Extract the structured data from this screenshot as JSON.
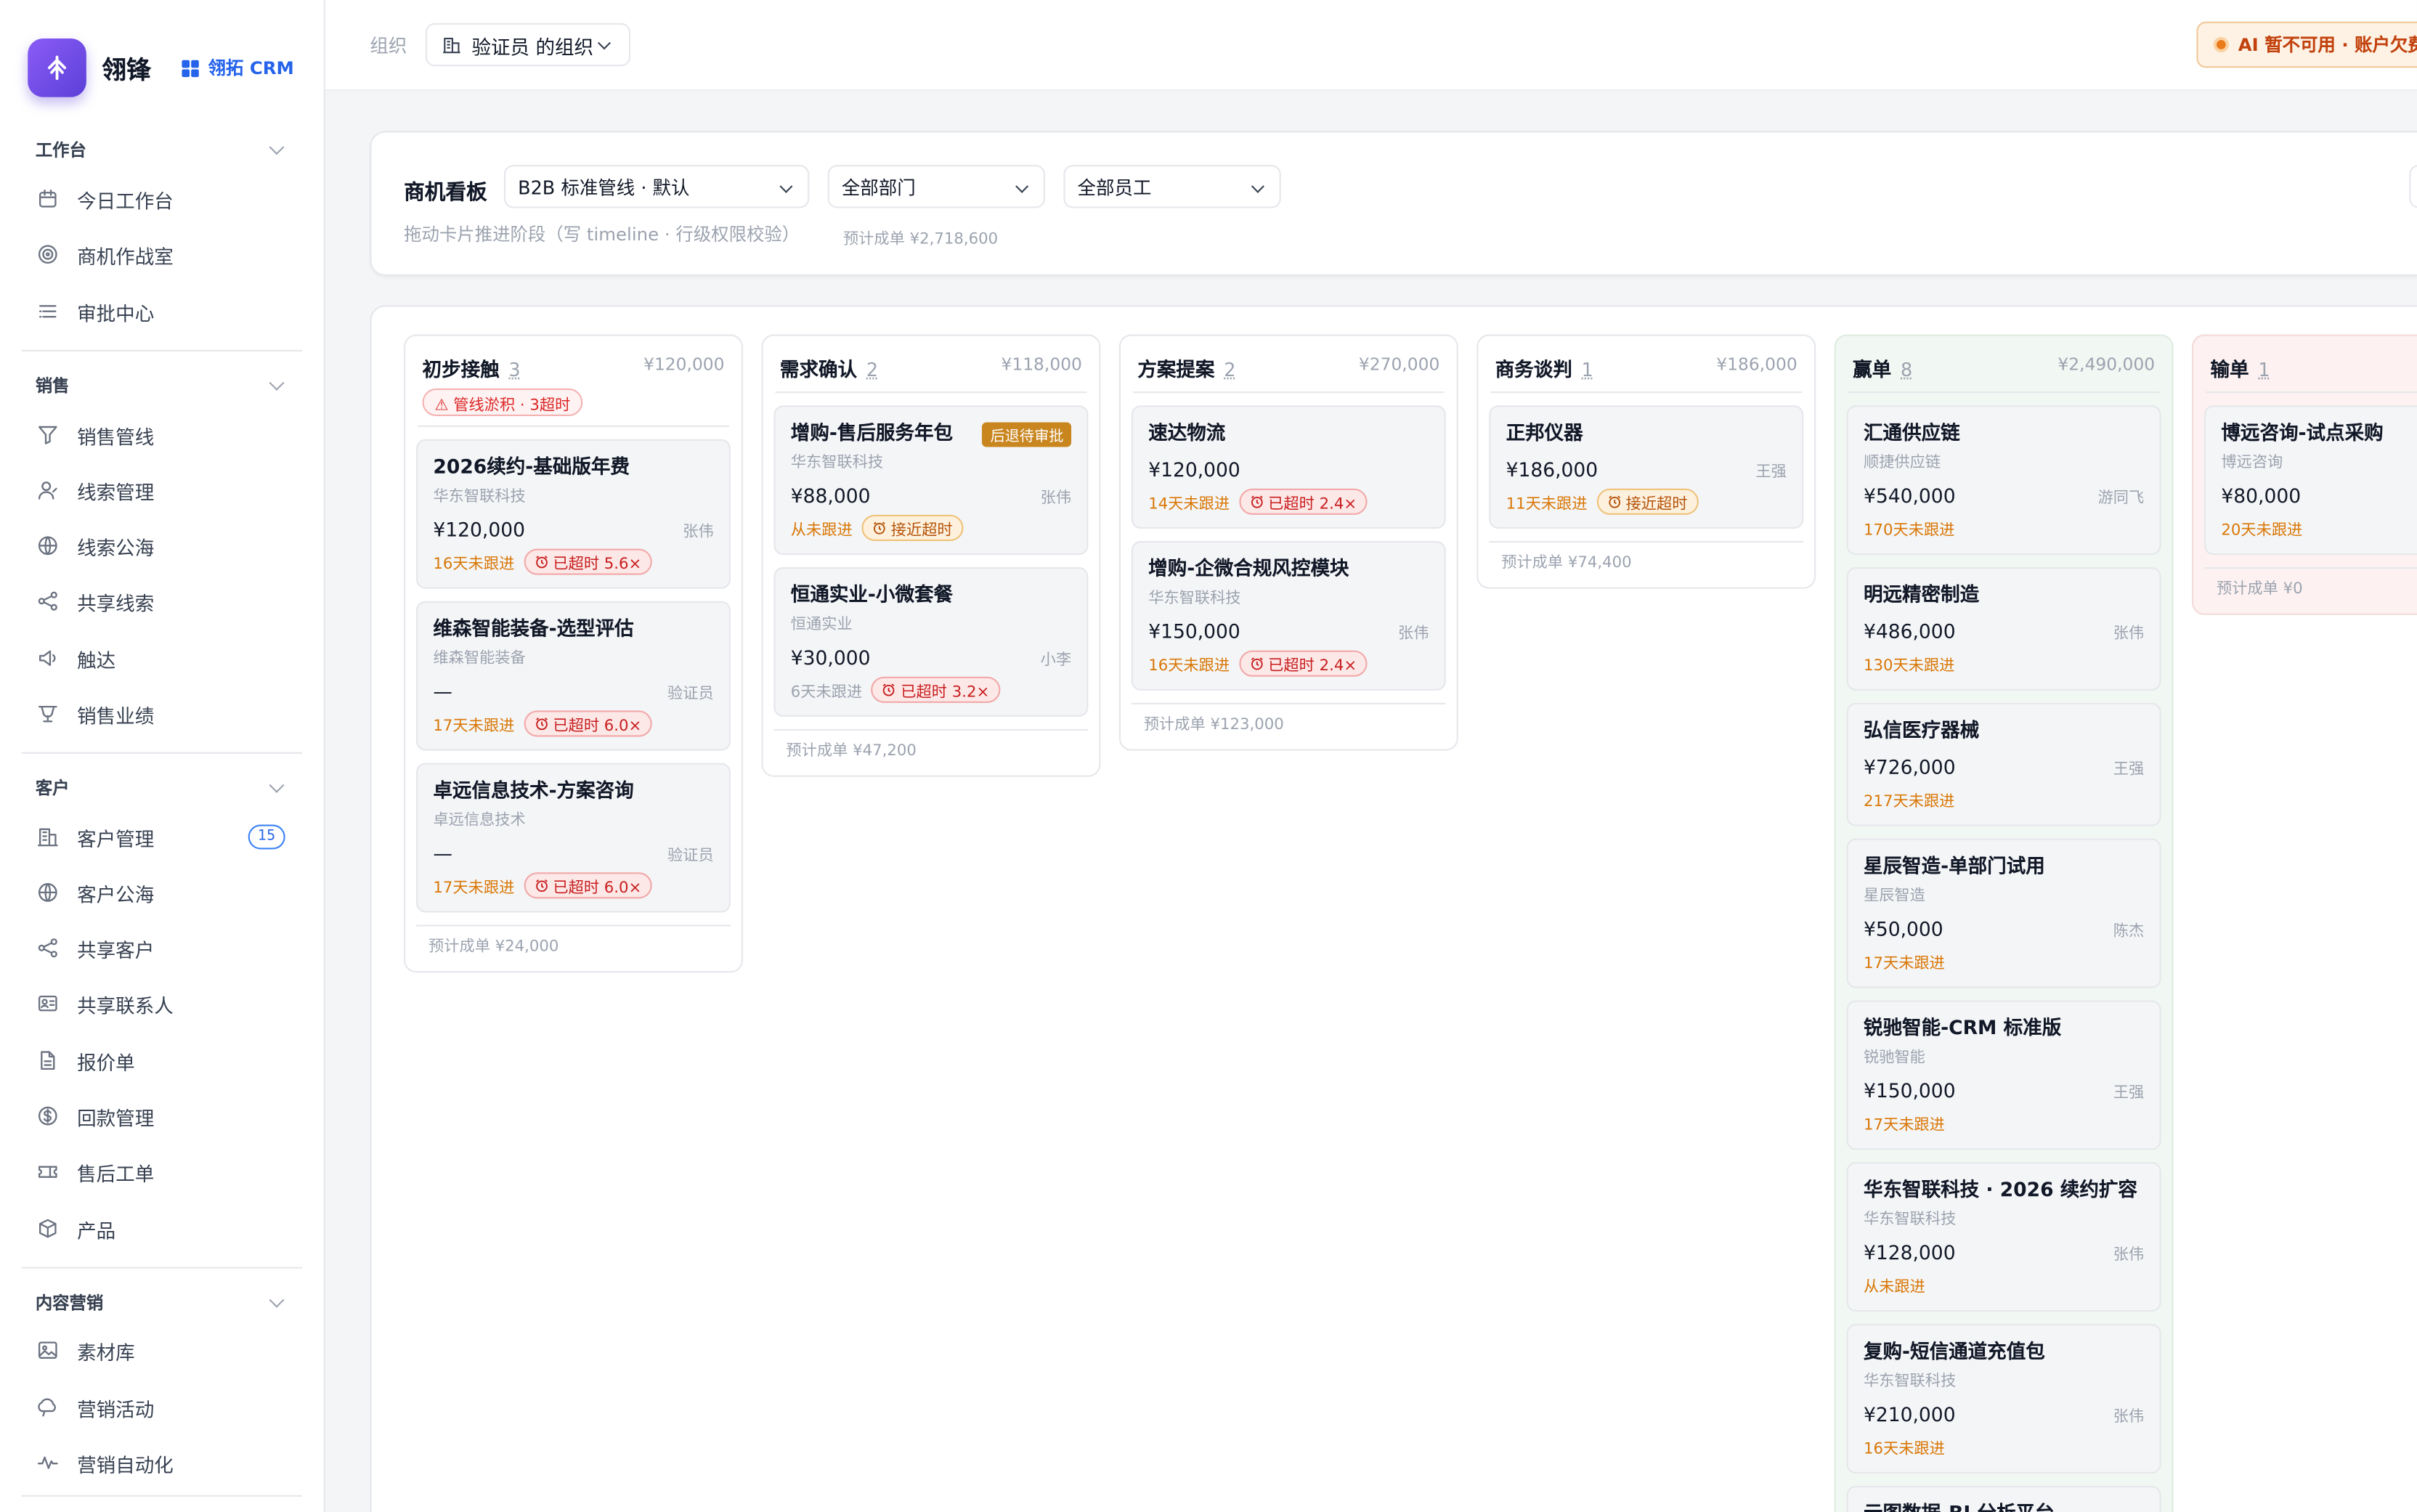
{
  "brand": {
    "name": "翎锋",
    "product": "翎拓 CRM"
  },
  "sidebar": {
    "sections": [
      {
        "title": "工作台",
        "items": [
          {
            "label": "今日工作台",
            "icon": "calendar-icon"
          },
          {
            "label": "商机作战室",
            "icon": "target-icon"
          },
          {
            "label": "审批中心",
            "icon": "list-icon"
          }
        ]
      },
      {
        "title": "销售",
        "items": [
          {
            "label": "销售管线",
            "icon": "funnel-icon"
          },
          {
            "label": "线索管理",
            "icon": "user-icon"
          },
          {
            "label": "线索公海",
            "icon": "globe-icon"
          },
          {
            "label": "共享线索",
            "icon": "share-icon"
          },
          {
            "label": "触达",
            "icon": "megaphone-icon"
          },
          {
            "label": "销售业绩",
            "icon": "trophy-icon"
          }
        ]
      },
      {
        "title": "客户",
        "items": [
          {
            "label": "客户管理",
            "icon": "building-icon",
            "count": "15"
          },
          {
            "label": "客户公海",
            "icon": "globe-icon"
          },
          {
            "label": "共享客户",
            "icon": "share-icon"
          },
          {
            "label": "共享联系人",
            "icon": "contact-card-icon"
          },
          {
            "label": "报价单",
            "icon": "document-icon"
          },
          {
            "label": "回款管理",
            "icon": "dollar-icon"
          },
          {
            "label": "售后工单",
            "icon": "ticket-icon"
          },
          {
            "label": "产品",
            "icon": "box-icon"
          }
        ]
      },
      {
        "title": "内容营销",
        "items": [
          {
            "label": "素材库",
            "icon": "image-icon"
          },
          {
            "label": "营销活动",
            "icon": "campaign-icon"
          },
          {
            "label": "营销自动化",
            "icon": "activity-icon"
          }
        ]
      }
    ]
  },
  "header": {
    "org_label": "组织",
    "org_value": "验证员 的组织",
    "ai_status": "AI 暂不可用 · 账户欠费"
  },
  "panel": {
    "title": "商机看板",
    "pipeline": "B2B 标准管线 · 默认",
    "department": "全部部门",
    "employee": "全部员工",
    "hint": "拖动卡片推进阶段（写 timeline · 行级权限校验）",
    "forecast": "预计成单 ¥2,718,600"
  },
  "columns": [
    {
      "name": "初步接触",
      "count": "3",
      "amount": "¥120,000",
      "alert": "⚠ 管线淤积 · 3超时",
      "footer": "预计成单 ¥24,000",
      "cards": [
        {
          "title": "2026续约-基础版年费",
          "company": "华东智联科技",
          "amount": "¥120,000",
          "owner": "张伟",
          "due": "16天未跟进",
          "chip": "已超时 5.6×",
          "chip_type": "red"
        },
        {
          "title": "维森智能装备-选型评估",
          "company": "维森智能装备",
          "amount": "—",
          "owner": "验证员",
          "due": "17天未跟进",
          "chip": "已超时 6.0×",
          "chip_type": "red"
        },
        {
          "title": "卓远信息技术-方案咨询",
          "company": "卓远信息技术",
          "amount": "—",
          "owner": "验证员",
          "due": "17天未跟进",
          "chip": "已超时 6.0×",
          "chip_type": "red"
        }
      ]
    },
    {
      "name": "需求确认",
      "count": "2",
      "amount": "¥118,000",
      "footer": "预计成单 ¥47,200",
      "cards": [
        {
          "title": "增购-售后服务年包",
          "company": "华东智联科技",
          "amount": "¥88,000",
          "owner": "张伟",
          "due": "从未跟进",
          "chip": "接近超时",
          "chip_type": "amber",
          "tag": "后退待审批"
        },
        {
          "title": "恒通实业-小微套餐",
          "company": "恒通实业",
          "amount": "¥30,000",
          "owner": "小李",
          "due": "6天未跟进",
          "due_gray": true,
          "chip": "已超时 3.2×",
          "chip_type": "red"
        }
      ]
    },
    {
      "name": "方案提案",
      "count": "2",
      "amount": "¥270,000",
      "footer": "预计成单 ¥123,000",
      "cards": [
        {
          "title": "速达物流",
          "amount": "¥120,000",
          "due": "14天未跟进",
          "chip": "已超时 2.4×",
          "chip_type": "red"
        },
        {
          "title": "增购-企微合规风控模块",
          "company": "华东智联科技",
          "amount": "¥150,000",
          "owner": "张伟",
          "due": "16天未跟进",
          "chip": "已超时 2.4×",
          "chip_type": "red"
        }
      ]
    },
    {
      "name": "商务谈判",
      "count": "1",
      "amount": "¥186,000",
      "footer": "预计成单 ¥74,400",
      "cards": [
        {
          "title": "正邦仪器",
          "amount": "¥186,000",
          "owner": "王强",
          "due": "11天未跟进",
          "chip": "接近超时",
          "chip_type": "amber"
        }
      ]
    },
    {
      "name": "赢单",
      "count": "8",
      "amount": "¥2,490,000",
      "style": "win",
      "cards": [
        {
          "title": "汇通供应链",
          "company": "顺捷供应链",
          "amount": "¥540,000",
          "owner": "游同飞",
          "due": "170天未跟进"
        },
        {
          "title": "明远精密制造",
          "amount": "¥486,000",
          "owner": "张伟",
          "due": "130天未跟进"
        },
        {
          "title": "弘信医疗器械",
          "amount": "¥726,000",
          "owner": "王强",
          "due": "217天未跟进"
        },
        {
          "title": "星辰智造-单部门试用",
          "company": "星辰智造",
          "amount": "¥50,000",
          "owner": "陈杰",
          "due": "17天未跟进"
        },
        {
          "title": "锐驰智能-CRM 标准版",
          "company": "锐驰智能",
          "amount": "¥150,000",
          "owner": "王强",
          "due": "17天未跟进"
        },
        {
          "title": "华东智联科技 · 2026 续约扩容",
          "company": "华东智联科技",
          "amount": "¥128,000",
          "owner": "张伟",
          "due": "从未跟进"
        },
        {
          "title": "复购-短信通道充值包",
          "company": "华东智联科技",
          "amount": "¥210,000",
          "owner": "张伟",
          "due": "16天未跟进"
        },
        {
          "title": "云图数据-BI 分析平台",
          "amount": "",
          "owner": "",
          "due": ""
        }
      ]
    },
    {
      "name": "输单",
      "count": "1",
      "amount": "",
      "style": "lose",
      "footer": "预计成单 ¥0",
      "cards": [
        {
          "title": "博远咨询-试点采购",
          "company": "博远咨询",
          "amount": "¥80,000",
          "due": "20天未跟进"
        }
      ]
    }
  ]
}
